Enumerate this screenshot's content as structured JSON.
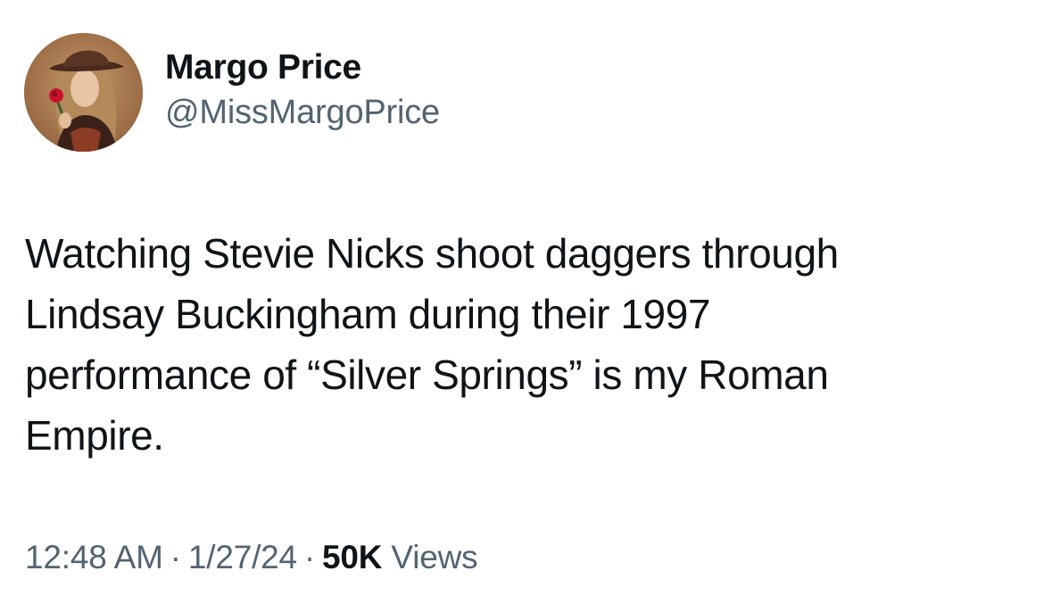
{
  "author": {
    "display_name": "Margo Price",
    "handle": "@MissMargoPrice",
    "avatar_icon": "profile-photo"
  },
  "tweet": {
    "text_lines": [
      "Watching Stevie Nicks shoot daggers through",
      "Lindsay Buckingham during their 1997",
      "performance of “Silver Springs” is my Roman",
      "Empire."
    ]
  },
  "meta": {
    "time": "12:48 AM",
    "separator": "·",
    "date": "1/27/24",
    "views_count": "50K",
    "views_label": "Views"
  },
  "colors": {
    "text_primary": "#0f1419",
    "text_secondary": "#536471",
    "background": "#ffffff"
  }
}
